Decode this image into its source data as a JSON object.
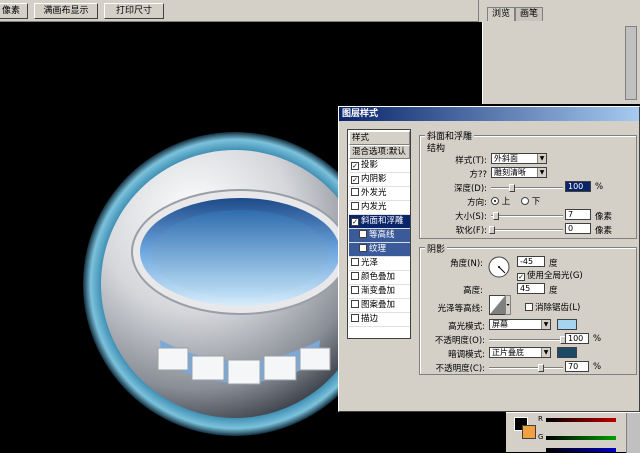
{
  "toolbar": {
    "btn1": "像素",
    "btn2": "满画布显示",
    "btn3": "打印尺寸"
  },
  "palette_tabs": [
    "浏览",
    "画笔"
  ],
  "dialog": {
    "title": "图层样式",
    "styles_header": "样式",
    "blend_options": "混合选项:默认",
    "items": [
      {
        "label": "投影",
        "checked": true
      },
      {
        "label": "内阴影",
        "checked": true
      },
      {
        "label": "外发光",
        "checked": false
      },
      {
        "label": "内发光",
        "checked": false
      },
      {
        "label": "斜面和浮雕",
        "checked": true
      },
      {
        "label": "等高线",
        "checked": false
      },
      {
        "label": "纹理",
        "checked": false
      },
      {
        "label": "光泽",
        "checked": false
      },
      {
        "label": "颜色叠加",
        "checked": false
      },
      {
        "label": "渐变叠加",
        "checked": false
      },
      {
        "label": "图案叠加",
        "checked": false
      },
      {
        "label": "描边",
        "checked": false
      }
    ],
    "bevel": {
      "section_title": "斜面和浮雕",
      "structure_title": "结构",
      "style_label": "样式(T):",
      "style_value": "外斜面",
      "technique_label": "方??",
      "technique_value": "雕刻清晰",
      "depth_label": "深度(D):",
      "depth_value": "100",
      "depth_unit": "%",
      "direction_label": "方向:",
      "dir_up": "上",
      "dir_down": "下",
      "size_label": "大小(S):",
      "size_value": "7",
      "size_unit": "像素",
      "soften_label": "软化(F):",
      "soften_value": "0",
      "soften_unit": "像素"
    },
    "shading": {
      "title": "阴影",
      "angle_label": "角度(N):",
      "angle_value": "-45",
      "angle_unit": "度",
      "global_light": "使用全局光(G)",
      "altitude_label": "高度:",
      "altitude_value": "45",
      "altitude_unit": "度",
      "gloss_label": "光泽等高线:",
      "antialias": "消除锯齿(L)",
      "highlight_label": "高光模式:",
      "highlight_value": "屏幕",
      "highlight_color": "#a6d4f0",
      "hl_opacity_label": "不透明度(O):",
      "hl_opacity_value": "100",
      "hl_opacity_unit": "%",
      "hl_opacity_level": 1.0,
      "shadow_label": "暗调模式:",
      "shadow_value": "正片叠底",
      "shadow_color": "#1c4a64",
      "sh_opacity_label": "不透明度(C):",
      "sh_opacity_value": "70",
      "sh_opacity_unit": "%",
      "sh_opacity_level": 0.7
    }
  },
  "colorpanel": {
    "r_label": "R",
    "g_label": "G"
  }
}
